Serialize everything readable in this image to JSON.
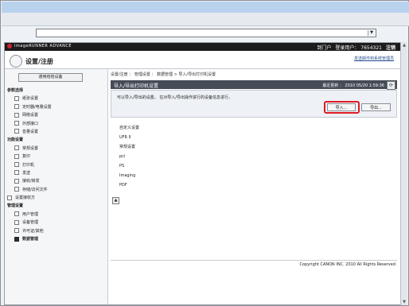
{
  "header": {
    "brand": "imageRUNNER ADVANCE",
    "portal": "到门户",
    "user": "登录用户： 7654321",
    "logout": "注销"
  },
  "subheader": {
    "title": "设置/注册",
    "mail_link": "发送邮件到系统管理员"
  },
  "sidebar": {
    "tool_button": "通用结结设备",
    "groups": [
      {
        "label": "参数选择",
        "items": [
          "纸张设置",
          "定时器/电量设置",
          "网络设置",
          "外部接口",
          "音量设置"
        ]
      },
      {
        "label": "功能设置",
        "items": [
          "常规设置",
          "复印",
          "打印机",
          "发送",
          "接收/转发",
          "存储/访问文件"
        ]
      },
      {
        "label": "",
        "items": [
          "设置接收方"
        ]
      },
      {
        "label": "管理设置",
        "items": [
          "用户管理",
          "设备管理",
          "许可证/其他",
          "数据管理"
        ]
      }
    ],
    "active": "数据管理"
  },
  "main": {
    "breadcrumb": "设置/注册 ： 管理设置 ： 数据管理 > 导入/导出打印机设置",
    "panel_title": "导入/导出打印机设置",
    "last_updated": "最近更新 ： 2010 05/20 1:59:36",
    "description": "可以导入/导出的设置。 在对导入/导出操作进行的设备信息进行。",
    "import_button": "导入...",
    "export_button": "导出...",
    "list": [
      "自定义设置",
      "UFR II",
      "常规设置",
      "pcl",
      "PS",
      "Imaging",
      "PDF"
    ],
    "footer": "Copyright CANON INC. 2010 All Rights Reserved"
  }
}
